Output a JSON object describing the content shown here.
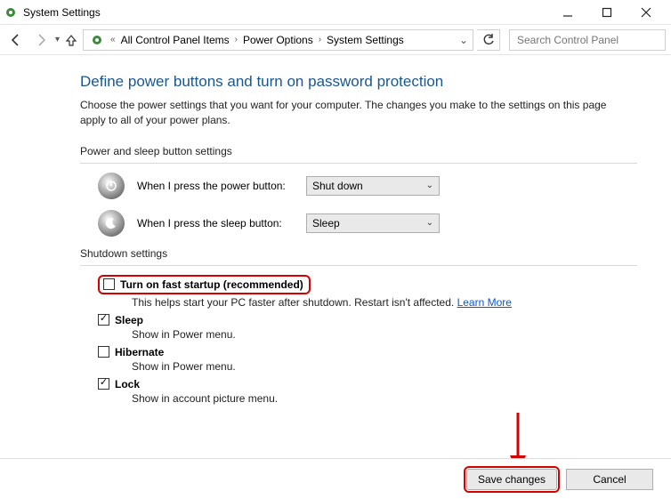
{
  "window": {
    "title": "System Settings"
  },
  "breadcrumb": {
    "item1": "All Control Panel Items",
    "item2": "Power Options",
    "item3": "System Settings"
  },
  "search": {
    "placeholder": "Search Control Panel"
  },
  "page": {
    "heading": "Define power buttons and turn on password protection",
    "description": "Choose the power settings that you want for your computer. The changes you make to the settings on this page apply to all of your power plans."
  },
  "buttons_section": {
    "label": "Power and sleep button settings",
    "power_label": "When I press the power button:",
    "power_value": "Shut down",
    "sleep_label": "When I press the sleep button:",
    "sleep_value": "Sleep"
  },
  "shutdown_section": {
    "label": "Shutdown settings",
    "fast_startup": {
      "title": "Turn on fast startup (recommended)",
      "desc": "This helps start your PC faster after shutdown. Restart isn't affected. ",
      "link": "Learn More"
    },
    "sleep": {
      "title": "Sleep",
      "desc": "Show in Power menu."
    },
    "hibernate": {
      "title": "Hibernate",
      "desc": "Show in Power menu."
    },
    "lock": {
      "title": "Lock",
      "desc": "Show in account picture menu."
    }
  },
  "footer": {
    "save": "Save changes",
    "cancel": "Cancel"
  }
}
